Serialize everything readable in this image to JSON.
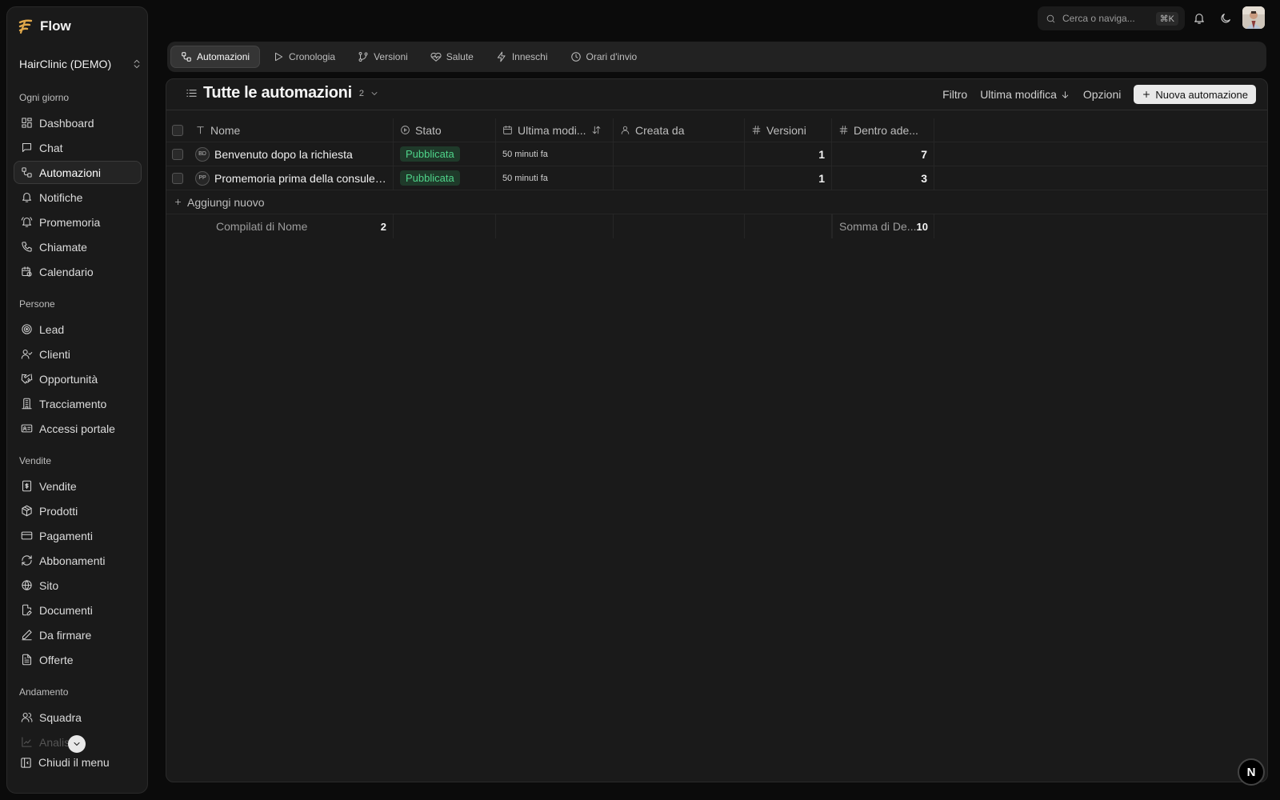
{
  "brand": {
    "name": "Flow"
  },
  "workspace": {
    "name": "HairClinic (DEMO)"
  },
  "sidebar": {
    "sections": [
      {
        "label": "Ogni giorno",
        "items": [
          {
            "label": "Dashboard",
            "icon": "dashboard-icon"
          },
          {
            "label": "Chat",
            "icon": "chat-icon"
          },
          {
            "label": "Automazioni",
            "icon": "workflow-icon",
            "active": true
          },
          {
            "label": "Notifiche",
            "icon": "bell-icon"
          },
          {
            "label": "Promemoria",
            "icon": "bell-ring-icon"
          },
          {
            "label": "Chiamate",
            "icon": "phone-icon"
          },
          {
            "label": "Calendario",
            "icon": "calendar-clock-icon"
          }
        ]
      },
      {
        "label": "Persone",
        "items": [
          {
            "label": "Lead",
            "icon": "target-icon"
          },
          {
            "label": "Clienti",
            "icon": "user-check-icon"
          },
          {
            "label": "Opportunità",
            "icon": "handshake-icon"
          },
          {
            "label": "Tracciamento",
            "icon": "building-icon"
          },
          {
            "label": "Accessi portale",
            "icon": "id-card-icon"
          }
        ]
      },
      {
        "label": "Vendite",
        "items": [
          {
            "label": "Vendite",
            "icon": "receipt-dollar-icon"
          },
          {
            "label": "Prodotti",
            "icon": "package-icon"
          },
          {
            "label": "Pagamenti",
            "icon": "credit-card-icon"
          },
          {
            "label": "Abbonamenti",
            "icon": "refresh-icon"
          },
          {
            "label": "Sito",
            "icon": "globe-icon"
          },
          {
            "label": "Documenti",
            "icon": "file-edit-icon"
          },
          {
            "label": "Da firmare",
            "icon": "pen-icon"
          },
          {
            "label": "Offerte",
            "icon": "file-text-icon"
          }
        ]
      },
      {
        "label": "Andamento",
        "items": [
          {
            "label": "Squadra",
            "icon": "users-icon"
          },
          {
            "label": "Analisi",
            "icon": "chart-icon"
          }
        ]
      }
    ],
    "collapse_label": "Chiudi il menu"
  },
  "topbar": {
    "search_placeholder": "Cerca o naviga...",
    "search_shortcut": "⌘K"
  },
  "tabs": [
    {
      "label": "Automazioni",
      "icon": "workflow-icon",
      "active": true
    },
    {
      "label": "Cronologia",
      "icon": "play-icon"
    },
    {
      "label": "Versioni",
      "icon": "git-branch-icon"
    },
    {
      "label": "Salute",
      "icon": "heart-pulse-icon"
    },
    {
      "label": "Inneschi",
      "icon": "zap-icon"
    },
    {
      "label": "Orari d'invio",
      "icon": "clock-icon"
    }
  ],
  "view": {
    "title": "Tutte le automazioni",
    "count": "2",
    "filter_label": "Filtro",
    "sort_label": "Ultima modifica",
    "options_label": "Opzioni",
    "new_label": "Nuova automazione"
  },
  "table": {
    "columns": {
      "name": "Nome",
      "stato": "Stato",
      "ultima": "Ultima modi...",
      "creata": "Creata da",
      "versioni": "Versioni",
      "dentro": "Dentro ade..."
    },
    "rows": [
      {
        "initials": "BD",
        "name": "Benvenuto dopo la richiesta",
        "stato": "Pubblicata",
        "ultima": "50 minuti fa",
        "creata": "",
        "versioni": "1",
        "dentro": "7"
      },
      {
        "initials": "PP",
        "name": "Promemoria prima della consulen...",
        "stato": "Pubblicata",
        "ultima": "50 minuti fa",
        "creata": "",
        "versioni": "1",
        "dentro": "3"
      }
    ],
    "add_label": "Aggiungi nuovo",
    "summary": {
      "name_label": "Compilati di Nome",
      "name_value": "2",
      "dentro_label": "Somma di De...",
      "dentro_value": "10"
    }
  },
  "footer_badge": "N",
  "colors": {
    "accent_published": "#4fd48a",
    "brand": "#e0a84a"
  }
}
